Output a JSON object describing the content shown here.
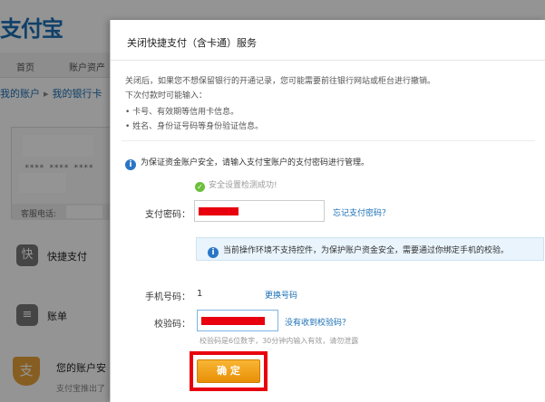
{
  "background": {
    "logo": "支付宝",
    "nav": [
      "首页",
      "账户资产"
    ],
    "breadcrumb": [
      "我的账户",
      "我的银行卡"
    ],
    "card_number": "**** **** ****",
    "card_phone_label": "客服电话:",
    "menu": [
      {
        "icon": "快",
        "label": "快捷支付"
      },
      {
        "icon": "≡",
        "label": "账单"
      }
    ],
    "security": {
      "icon": "支",
      "title": "您的账户安",
      "subtitle": "支付宝推出了"
    }
  },
  "dialog": {
    "title": "关闭快捷支付（含卡通）服务",
    "notes": [
      "关闭后，如果您不想保留银行的开通记录，您可能需要前往银行网站或柜台进行撤销。",
      "下次付款时可能输入：",
      "• 卡号、有效期等信用卡信息。",
      "• 姓名、身份证号码等身份验证信息。"
    ],
    "info_text": "为保证资金账户安全，请输入支付宝账户的支付密码进行管理。",
    "check_text": "安全设置检测成功!",
    "password": {
      "label": "支付密码：",
      "forgot_link": "忘记支付密码？"
    },
    "warning": "当前操作环境不支持控件，为保护账户资金安全，需要通过你绑定手机的校验。",
    "phone": {
      "label": "手机号码：",
      "value": "1",
      "change_link": "更换号码"
    },
    "code": {
      "label": "校验码：",
      "resend_link": "没有收到校验码？",
      "hint": "校验码是6位数字，30分钟内输入有效，请勿泄露"
    },
    "confirm_label": "确 定"
  },
  "colors": {
    "brand": "#1a6fb5",
    "button": "#f0a21f",
    "highlight": "#e8000e"
  }
}
